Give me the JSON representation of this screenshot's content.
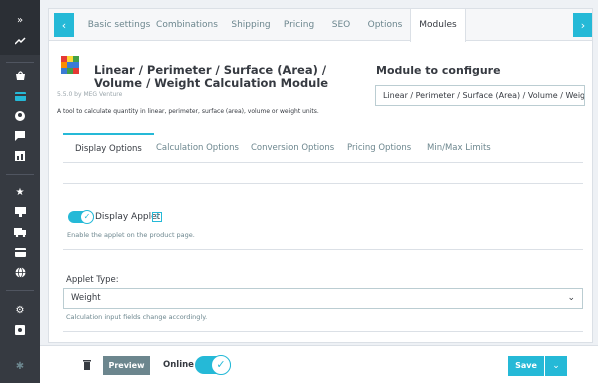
{
  "sidebar": {
    "collapse_icon": "double-chevron-right-icon",
    "items": [
      {
        "icon": "trend-icon"
      },
      {
        "icon": "shopping-bag-icon"
      },
      {
        "icon": "card-icon",
        "active": true
      },
      {
        "icon": "user-icon"
      },
      {
        "icon": "chat-icon"
      },
      {
        "icon": "chart-icon"
      },
      {
        "icon": "puzzle-icon"
      },
      {
        "icon": "monitor-icon"
      },
      {
        "icon": "truck-icon"
      },
      {
        "icon": "payment-icon"
      },
      {
        "icon": "globe-icon"
      },
      {
        "icon": "gear-icon"
      },
      {
        "icon": "settings-box-icon"
      },
      {
        "icon": "module-icon"
      }
    ]
  },
  "tabs": [
    {
      "label": "Basic settings"
    },
    {
      "label": "Combinations"
    },
    {
      "label": "Shipping"
    },
    {
      "label": "Pricing"
    },
    {
      "label": "SEO"
    },
    {
      "label": "Options"
    },
    {
      "label": "Modules",
      "active": true
    }
  ],
  "module": {
    "title": "Linear / Perimeter / Surface (Area) / Volume / Weight Calculation Module",
    "version": "5.5.0 by MEG Venture",
    "description": "A tool to calculate quantity in linear, perimeter, surface (area), volume or weight units."
  },
  "configure": {
    "label": "Module to configure",
    "value": "Linear / Perimeter / Surface (Area) / Volume / Weig..."
  },
  "subtabs": [
    {
      "label": "Display Options",
      "active": true
    },
    {
      "label": "Calculation Options"
    },
    {
      "label": "Conversion Options"
    },
    {
      "label": "Pricing Options"
    },
    {
      "label": "Min/Max Limits"
    }
  ],
  "applet": {
    "label": "Display Applet",
    "help_badge": "?",
    "help": "Enable the applet on the product page.",
    "enabled": true
  },
  "applet_type": {
    "label": "Applet Type:",
    "value": "Weight",
    "help": "Calculation input fields change accordingly."
  },
  "footer": {
    "preview_label": "Preview",
    "online_label": "Online",
    "online_enabled": true,
    "save_label": "Save"
  },
  "colors": {
    "accent": "#25b9d7",
    "sidebar": "#363a41",
    "secondary_button": "#6c868e"
  }
}
